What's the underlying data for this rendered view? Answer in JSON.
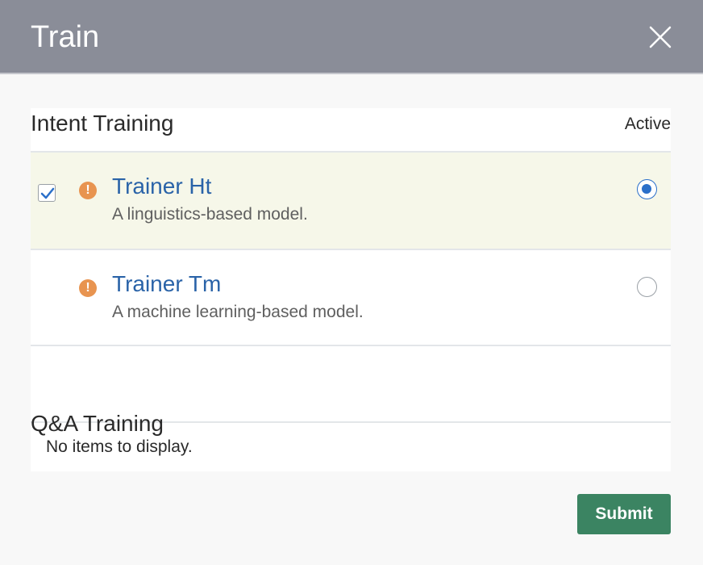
{
  "dialog": {
    "title": "Train",
    "close_icon": "close-icon"
  },
  "intent_training": {
    "title": "Intent Training",
    "active_label": "Active",
    "trainers": [
      {
        "name": "Trainer Ht",
        "description": "A linguistics-based model.",
        "checked": true,
        "active": true,
        "status_icon": "warning-icon"
      },
      {
        "name": "Trainer Tm",
        "description": "A machine learning-based model.",
        "checked": false,
        "active": false,
        "status_icon": "warning-icon"
      }
    ]
  },
  "qa_training": {
    "title": "Q&A Training",
    "empty_message": "No items to display."
  },
  "footer": {
    "submit_label": "Submit"
  },
  "colors": {
    "header_bg": "#8a8d98",
    "link": "#2a63a8",
    "warning": "#e89450",
    "radio_active": "#2a6fc9",
    "submit_bg": "#3b8462",
    "selected_row_bg": "#f6f7e9"
  }
}
